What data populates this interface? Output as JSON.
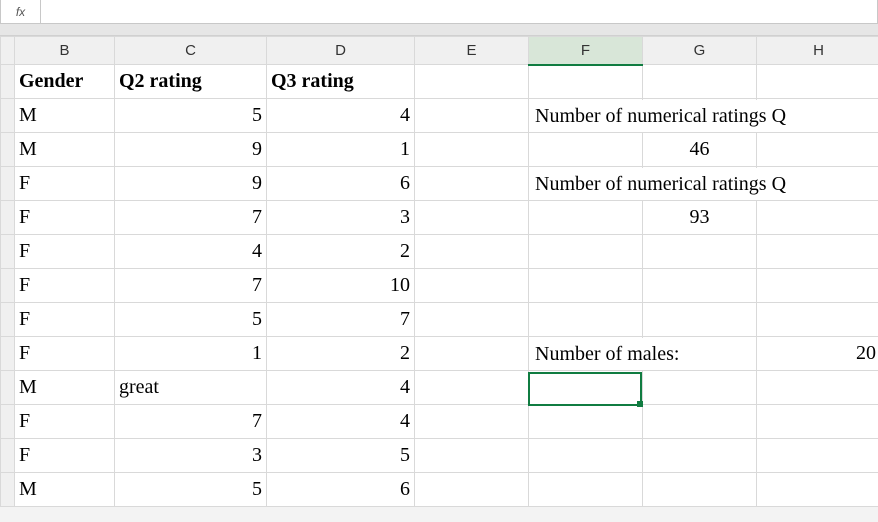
{
  "fx_label": "fx",
  "fx_value": "",
  "columns": [
    "B",
    "C",
    "D",
    "E",
    "F",
    "G",
    "H"
  ],
  "headers": {
    "b": "Gender",
    "c": "Q2 rating",
    "d": "Q3 rating"
  },
  "rows": [
    {
      "b": "M",
      "c": "5",
      "d": "4"
    },
    {
      "b": "M",
      "c": "9",
      "d": "1"
    },
    {
      "b": "F",
      "c": "9",
      "d": "6"
    },
    {
      "b": "F",
      "c": "7",
      "d": "3"
    },
    {
      "b": "F",
      "c": "4",
      "d": "2"
    },
    {
      "b": "F",
      "c": "7",
      "d": "10"
    },
    {
      "b": "F",
      "c": "5",
      "d": "7"
    },
    {
      "b": "F",
      "c": "1",
      "d": "2"
    },
    {
      "b": "M",
      "c": "great",
      "d": "4",
      "c_is_text": true
    },
    {
      "b": "F",
      "c": "7",
      "d": "4"
    },
    {
      "b": "F",
      "c": "3",
      "d": "5"
    },
    {
      "b": "M",
      "c": "5",
      "d": "6"
    }
  ],
  "side": {
    "label1": "Number of numerical ratings Q",
    "val1": "46",
    "label2": "Number of numerical ratings Q",
    "val2": "93",
    "label3": "Number of males:",
    "val3": "20"
  },
  "chart_data": {
    "type": "table",
    "title": "",
    "columns": [
      "Gender",
      "Q2 rating",
      "Q3 rating"
    ],
    "data": [
      [
        "M",
        5,
        4
      ],
      [
        "M",
        9,
        1
      ],
      [
        "F",
        9,
        6
      ],
      [
        "F",
        7,
        3
      ],
      [
        "F",
        4,
        2
      ],
      [
        "F",
        7,
        10
      ],
      [
        "F",
        5,
        7
      ],
      [
        "F",
        1,
        2
      ],
      [
        "M",
        "great",
        4
      ],
      [
        "F",
        7,
        4
      ],
      [
        "F",
        3,
        5
      ],
      [
        "M",
        5,
        6
      ]
    ],
    "summary": {
      "Number of numerical ratings Q2": 46,
      "Number of numerical ratings Q3": 93,
      "Number of males": 20
    }
  }
}
